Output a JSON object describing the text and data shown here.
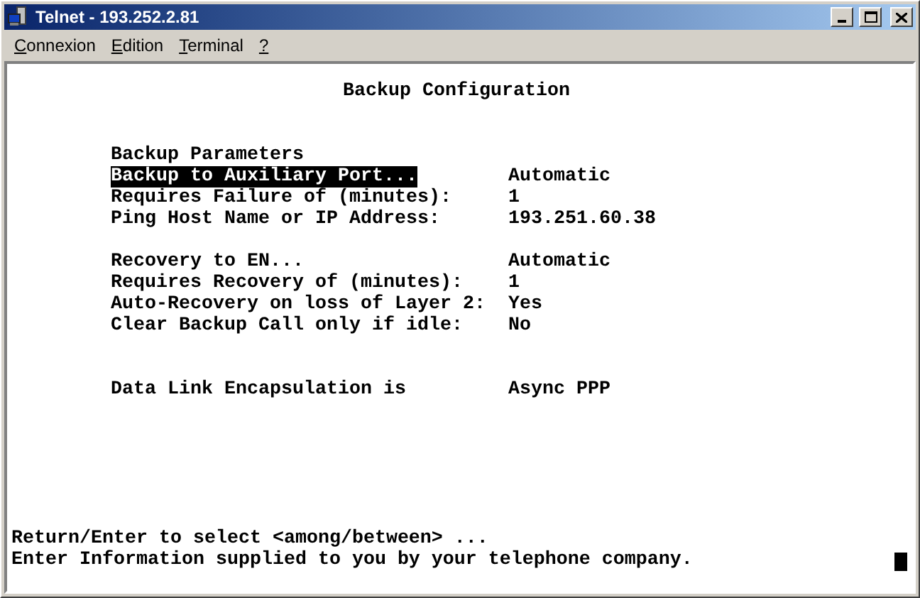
{
  "window": {
    "title": "Telnet - 193.252.2.81"
  },
  "menu": [
    "Connexion",
    "Edition",
    "Terminal",
    "?"
  ],
  "screen": {
    "title": "Backup Configuration",
    "heading": "Backup Parameters",
    "groups": [
      {
        "rows": [
          {
            "label": "Backup to Auxiliary Port...",
            "value": "Automatic",
            "selected": true
          },
          {
            "label": "Requires Failure of (minutes):",
            "value": "1",
            "selected": false
          },
          {
            "label": "Ping Host Name or IP Address:",
            "value": "193.251.60.38",
            "selected": false
          }
        ]
      },
      {
        "rows": [
          {
            "label": "Recovery to EN...",
            "value": "Automatic",
            "selected": false
          },
          {
            "label": "Requires Recovery of (minutes):",
            "value": "1",
            "selected": false
          },
          {
            "label": "Auto-Recovery on loss of Layer 2:",
            "value": "Yes",
            "selected": false
          },
          {
            "label": "Clear Backup Call only if idle:",
            "value": "No",
            "selected": false
          }
        ]
      },
      {
        "rows": [
          {
            "label": "Data Link Encapsulation is",
            "value": "Async PPP",
            "selected": false
          }
        ]
      }
    ],
    "status_lines": [
      "Return/Enter to select <among/between> ...",
      "Enter Information supplied to you by your telephone company."
    ]
  }
}
